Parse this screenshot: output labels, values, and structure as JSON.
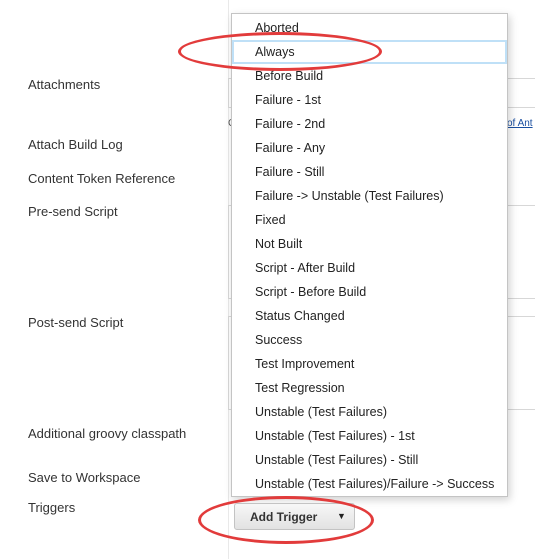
{
  "labels": {
    "attachments": "Attachments",
    "attach_build_log": "Attach Build Log",
    "content_token_reference": "Content Token Reference",
    "pre_send_script": "Pre-send Script",
    "post_send_script": "Post-send Script",
    "additional_groovy_classpath": "Additional groovy classpath",
    "save_to_workspace": "Save to Workspace",
    "triggers": "Triggers"
  },
  "hint_text": "C",
  "link_fragment": "of Ant",
  "dropdown": {
    "highlighted_index": 1,
    "items": [
      "Aborted",
      "Always",
      "Before Build",
      "Failure - 1st",
      "Failure - 2nd",
      "Failure - Any",
      "Failure - Still",
      "Failure -> Unstable (Test Failures)",
      "Fixed",
      "Not Built",
      "Script - After Build",
      "Script - Before Build",
      "Status Changed",
      "Success",
      "Test Improvement",
      "Test Regression",
      "Unstable (Test Failures)",
      "Unstable (Test Failures) - 1st",
      "Unstable (Test Failures) - Still",
      "Unstable (Test Failures)/Failure -> Success"
    ]
  },
  "add_trigger_button": {
    "label": "Add Trigger",
    "caret": "▼"
  },
  "colors": {
    "annotation": "#e23b3b",
    "highlight_border": "#bfe0f7",
    "link": "#1a4fa0"
  }
}
